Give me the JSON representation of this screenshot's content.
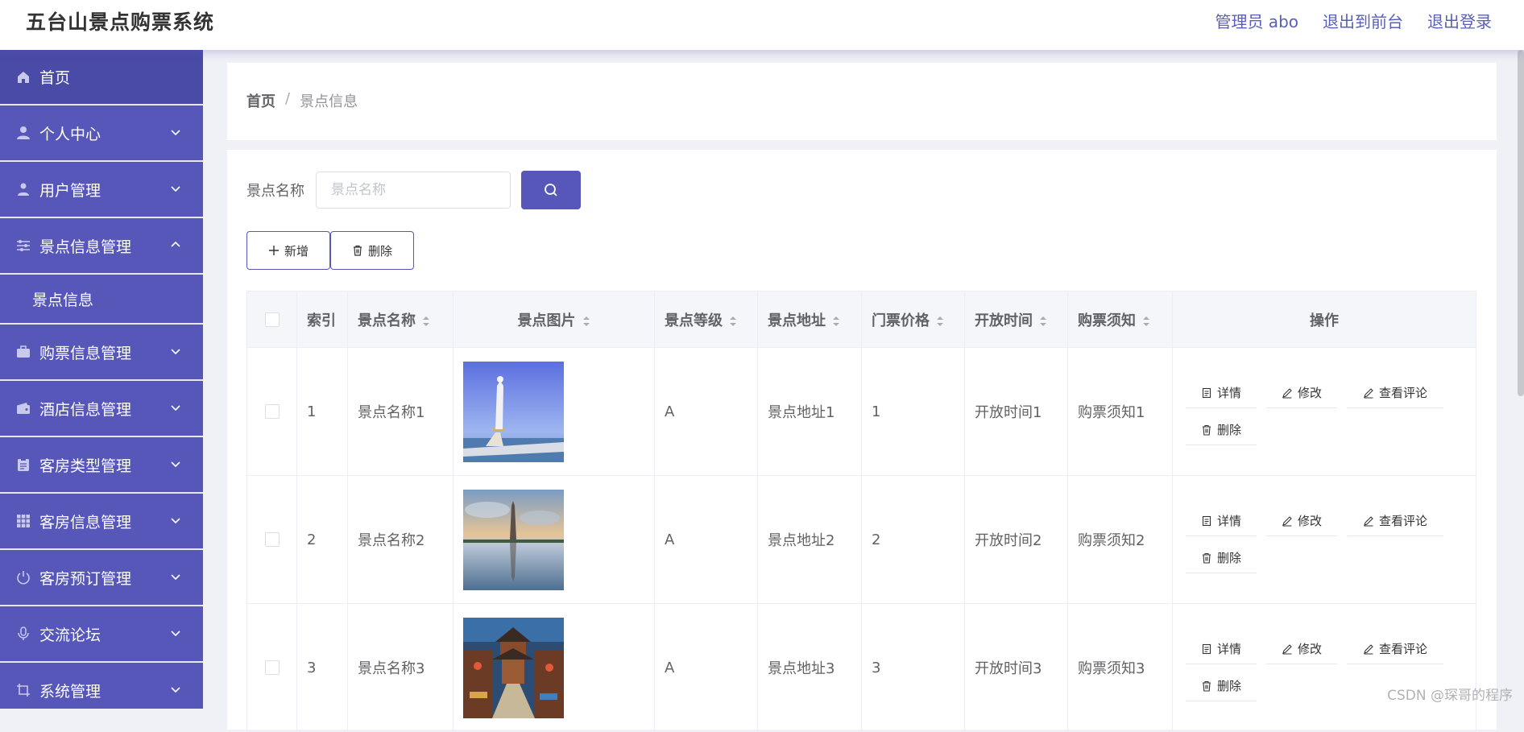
{
  "header": {
    "app_title": "五台山景点购票系统",
    "user_label": "管理员 abo",
    "back_front": "退出到前台",
    "logout": "退出登录"
  },
  "sidebar": {
    "items": [
      {
        "label": "首页",
        "icon": "home-icon"
      },
      {
        "label": "个人中心",
        "icon": "user-icon"
      },
      {
        "label": "用户管理",
        "icon": "user-manage-icon"
      },
      {
        "label": "景点信息管理",
        "icon": "sliders-icon",
        "expanded": true
      },
      {
        "label": "购票信息管理",
        "icon": "briefcase-icon"
      },
      {
        "label": "酒店信息管理",
        "icon": "wallet-icon"
      },
      {
        "label": "客房类型管理",
        "icon": "clipboard-icon"
      },
      {
        "label": "客房信息管理",
        "icon": "grid-icon"
      },
      {
        "label": "客房预订管理",
        "icon": "power-icon"
      },
      {
        "label": "交流论坛",
        "icon": "mic-icon"
      },
      {
        "label": "系统管理",
        "icon": "crop-icon"
      }
    ],
    "sub_item": "景点信息"
  },
  "breadcrumb": {
    "home": "首页",
    "separator": "/",
    "current": "景点信息"
  },
  "search": {
    "label": "景点名称",
    "placeholder": "景点名称"
  },
  "actions": {
    "add": "新增",
    "delete": "删除"
  },
  "table": {
    "headers": [
      "索引",
      "景点名称",
      "景点图片",
      "景点等级",
      "景点地址",
      "门票价格",
      "开放时间",
      "购票须知",
      "操作"
    ],
    "rows": [
      {
        "index": "1",
        "name": "景点名称1",
        "level": "A",
        "address": "景点地址1",
        "price": "1",
        "open": "开放时间1",
        "notice": "购票须知1"
      },
      {
        "index": "2",
        "name": "景点名称2",
        "level": "A",
        "address": "景点地址2",
        "price": "2",
        "open": "开放时间2",
        "notice": "购票须知2"
      },
      {
        "index": "3",
        "name": "景点名称3",
        "level": "A",
        "address": "景点地址3",
        "price": "3",
        "open": "开放时间3",
        "notice": "购票须知3"
      }
    ],
    "ops": {
      "detail": "详情",
      "edit": "修改",
      "comments": "查看评论",
      "delete": "删除"
    }
  },
  "watermark": "CSDN @琛哥的程序",
  "colors": {
    "accent": "#5657b8",
    "sidebar_bg": "#5657b8",
    "header_link": "#5a5fb6"
  }
}
